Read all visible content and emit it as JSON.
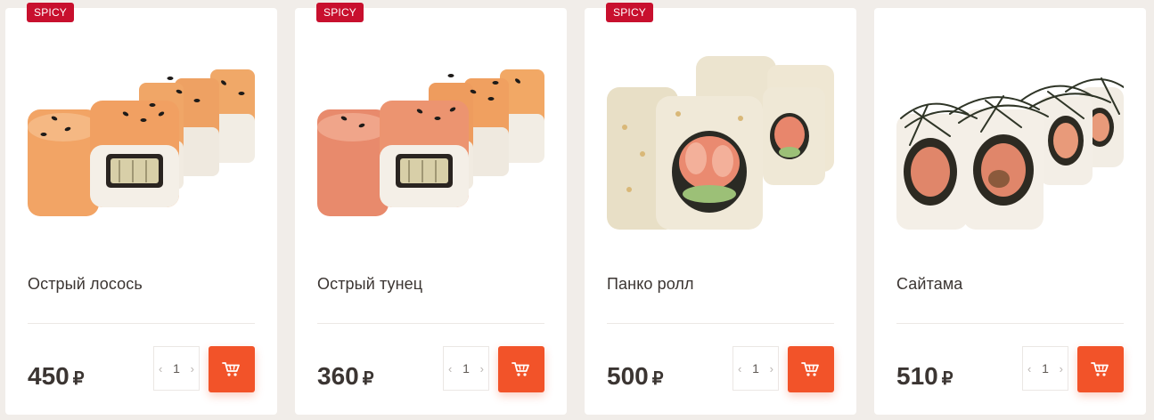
{
  "products": [
    {
      "badge": "SPICY",
      "name": "Острый лосось",
      "price": "450",
      "currency": "₽",
      "qty": "1",
      "photo": "salmon-roll-photo"
    },
    {
      "badge": "SPICY",
      "name": "Острый тунец",
      "price": "360",
      "currency": "₽",
      "qty": "1",
      "photo": "tuna-roll-photo"
    },
    {
      "badge": "SPICY",
      "name": "Панко ролл",
      "price": "500",
      "currency": "₽",
      "qty": "1",
      "photo": "panko-roll-photo"
    },
    {
      "badge": "",
      "name": "Сайтама",
      "price": "510",
      "currency": "₽",
      "qty": "1",
      "photo": "saitama-roll-photo"
    }
  ],
  "icons": {
    "decrement": "chevron-left-icon",
    "increment": "chevron-right-icon",
    "cart": "cart-icon"
  },
  "colors": {
    "page_bg": "#f1ede9",
    "card_bg": "#ffffff",
    "badge": "#c8102e",
    "accent": "#f25329",
    "text": "#3b3532"
  }
}
